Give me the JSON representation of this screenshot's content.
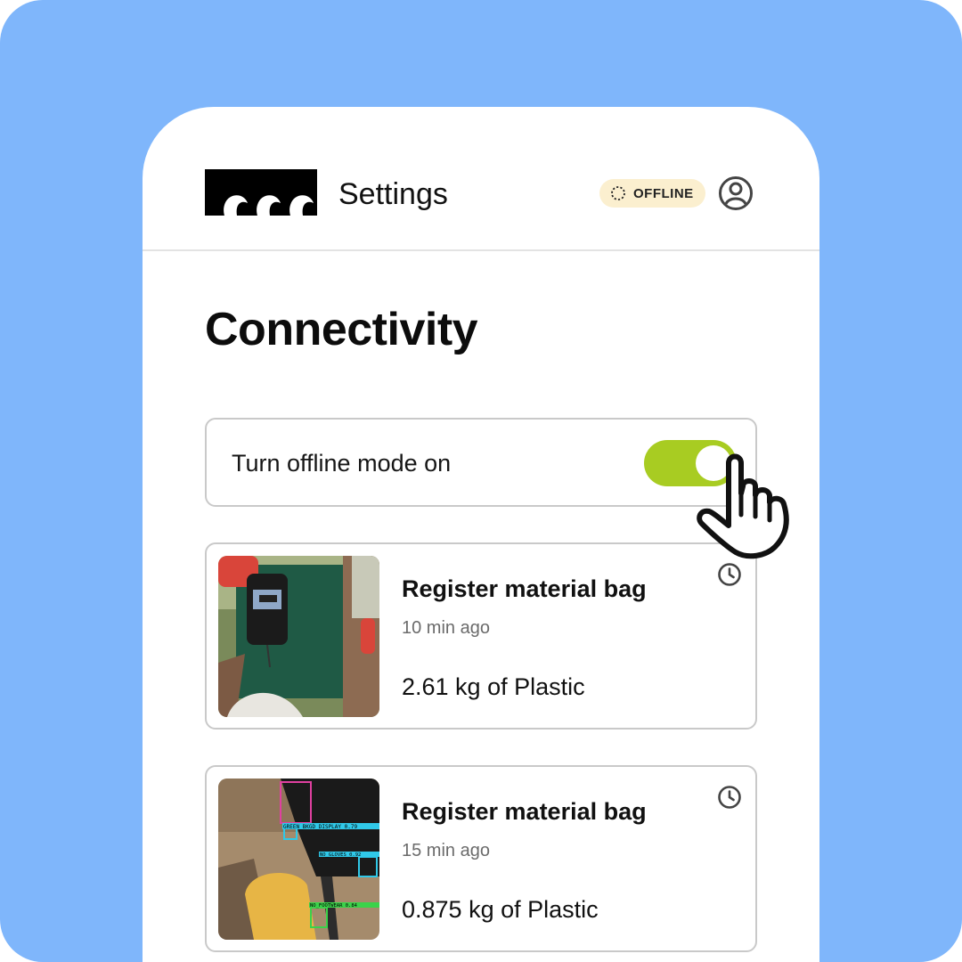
{
  "header": {
    "title": "Settings",
    "status_badge": "OFFLINE",
    "logo_icon": "wave-logo-icon",
    "avatar_icon": "user-circle-icon"
  },
  "section": {
    "title": "Connectivity"
  },
  "offline_toggle": {
    "label": "Turn offline mode on",
    "state": "on"
  },
  "activity": [
    {
      "title": "Register material bag",
      "time": "10 min ago",
      "weight": "2.61 kg of Plastic",
      "icon": "clock-icon"
    },
    {
      "title": "Register material bag",
      "time": "15 min ago",
      "weight": "0.875 kg of Plastic",
      "icon": "clock-icon",
      "detection_labels": [
        "GREEN_BKGD_DISPLAY 0.79",
        "NO_GLOVES 0.92",
        "NO_FOOTWEAR 0.84"
      ]
    }
  ],
  "colors": {
    "background": "#7fb6fb",
    "toggle_on": "#a8cc22",
    "badge_bg": "#fbefcf"
  }
}
